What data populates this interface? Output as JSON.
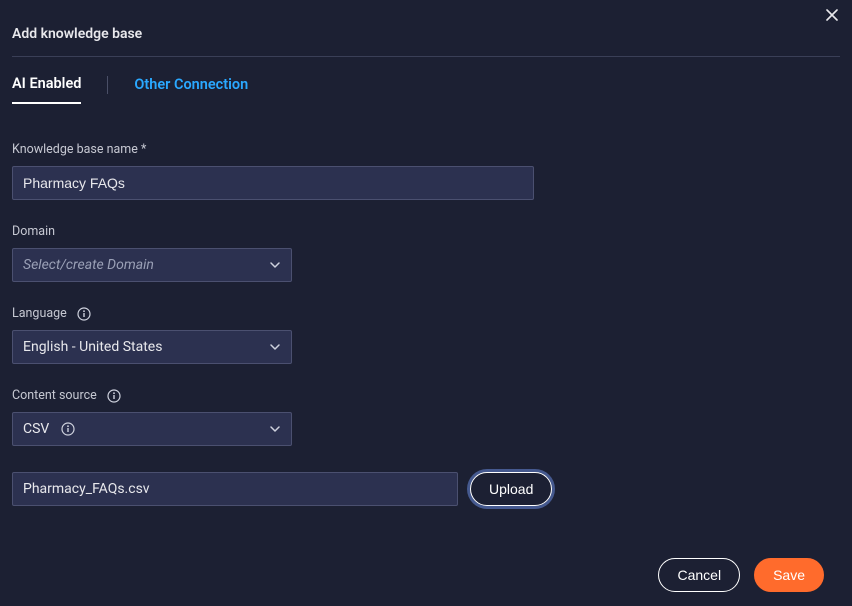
{
  "dialog": {
    "title": "Add knowledge base"
  },
  "tabs": {
    "active": "AI Enabled",
    "other": "Other Connection"
  },
  "form": {
    "name_label": "Knowledge base name *",
    "name_value": "Pharmacy FAQs",
    "domain_label": "Domain",
    "domain_placeholder": "Select/create Domain",
    "language_label": "Language",
    "language_value": "English - United States",
    "content_source_label": "Content source",
    "content_source_value": "CSV",
    "file_value": "Pharmacy_FAQs.csv",
    "upload_label": "Upload"
  },
  "footer": {
    "cancel": "Cancel",
    "save": "Save"
  }
}
